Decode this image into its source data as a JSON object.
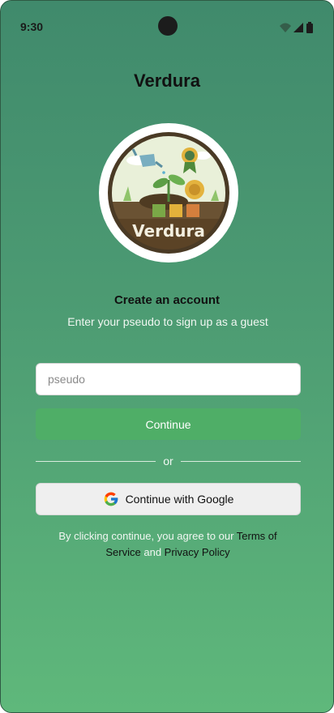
{
  "status": {
    "time": "9:30",
    "icons": [
      "wifi-icon",
      "signal-icon",
      "battery-icon"
    ]
  },
  "app": {
    "title": "Verdura",
    "logo_text": "Verdura"
  },
  "form": {
    "heading": "Create an account",
    "subheading": "Enter your pseudo to sign up as a guest",
    "input_placeholder": "pseudo",
    "continue_label": "Continue",
    "divider_text": "or",
    "google_label": "Continue with Google"
  },
  "legal": {
    "prefix": "By clicking continue, you agree to our ",
    "terms": "Terms of Service",
    "and": " and ",
    "privacy": "Privacy Policy"
  },
  "colors": {
    "accent": "#4fae67",
    "background_top": "#408a6c",
    "background_bottom": "#5fb87b"
  }
}
